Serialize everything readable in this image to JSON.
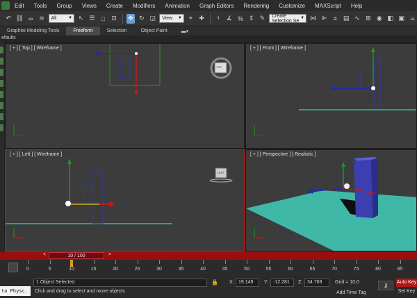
{
  "menu": [
    "Edit",
    "Tools",
    "Group",
    "Views",
    "Create",
    "Modifiers",
    "Animation",
    "Graph Editors",
    "Rendering",
    "Customize",
    "MAXScript",
    "Help"
  ],
  "toolbar": {
    "filter_value": "All",
    "refcoord_value": "View",
    "selection_set_placeholder": "Create Selection Se"
  },
  "ribbon": {
    "tabs": [
      "Graphite Modeling Tools",
      "Freeform",
      "Selection",
      "Object Paint"
    ],
    "selected_tab": "Freeform",
    "sub_label": "efaults"
  },
  "viewports": {
    "top": {
      "label": "[ + ] [ Top ] [ Wireframe ]",
      "cube_label": "TOP"
    },
    "front": {
      "label": "[ + ] [ Front ] [ Wireframe ]"
    },
    "left": {
      "label": "[ + ] [ Left ] [ Wireframe ]",
      "cube_label": "LEFT"
    },
    "perspective": {
      "label": "[ + ] [ Perspective ] [ Realistic ]"
    }
  },
  "timeline": {
    "slider_text": "10 / 100",
    "current_frame": 10,
    "total_frames": 100,
    "ticks": [
      0,
      5,
      10,
      15,
      20,
      25,
      30,
      35,
      40,
      45,
      50,
      55,
      60,
      65,
      70,
      75,
      80,
      85
    ]
  },
  "status": {
    "maxscript": "to Physc.",
    "selected": "1 Object Selected",
    "prompt": "Click and drag to select and move objects",
    "x_label": "X:",
    "x": "19.149",
    "y_label": "Y:",
    "y": "-12.281",
    "z_label": "Z:",
    "z": "34.769",
    "grid": "Grid = 10.0",
    "add_time_tag": "Add Time Tag",
    "auto_key": "Auto Key",
    "set_key": "Set Key"
  },
  "colors": {
    "accent_red": "#c11c1c",
    "timebar": "#9a0e0e",
    "teal_plane": "#3fb8a8",
    "box_blue": "#3b3fb0"
  }
}
